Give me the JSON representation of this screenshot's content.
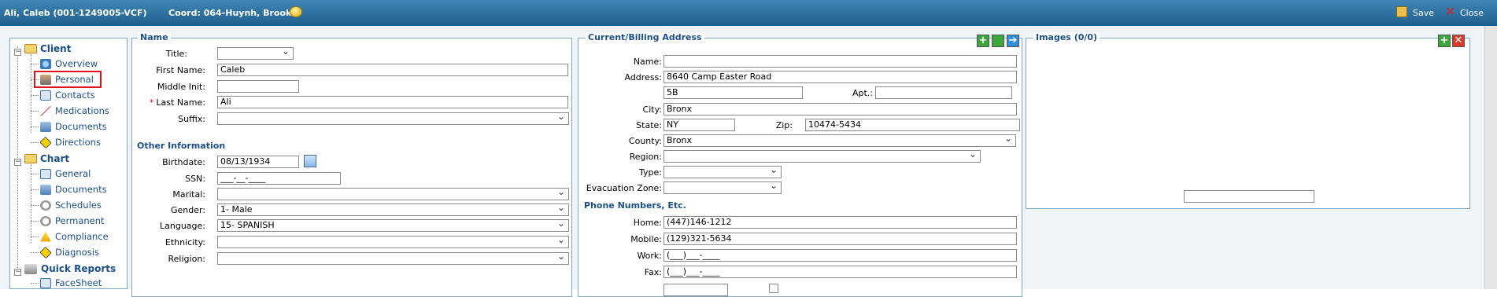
{
  "titlebar": {
    "patient": "Ali, Caleb (001-1249005-VCF)",
    "coord": "Coord: 064-Huynh, Brooks",
    "save_label": "Save",
    "close_label": "Close"
  },
  "sidebar": {
    "client": {
      "label": "Client",
      "items": [
        "Overview",
        "Personal",
        "Contacts",
        "Medications",
        "Documents",
        "Directions"
      ]
    },
    "chart": {
      "label": "Chart",
      "items": [
        "General",
        "Documents",
        "Schedules",
        "Permanent",
        "Compliance",
        "Diagnosis"
      ]
    },
    "reports": {
      "label": "Quick Reports",
      "items": [
        "FaceSheet"
      ]
    },
    "selected": "Personal"
  },
  "name_panel": {
    "title": "Name",
    "title_label": "Title:",
    "title_value": "",
    "first_name_label": "First Name:",
    "first_name": "Caleb",
    "middle_label": "Middle Init:",
    "middle": "",
    "last_name_label": "Last Name:",
    "last_name": "Ali",
    "suffix_label": "Suffix:",
    "suffix": "",
    "other_title": "Other Information",
    "birthdate_label": "Birthdate:",
    "birthdate": "08/13/1934",
    "ssn_label": "SSN:",
    "ssn": "___-__-____",
    "marital_label": "Marital:",
    "marital": "",
    "gender_label": "Gender:",
    "gender": "1- Male",
    "language_label": "Language:",
    "language": "15- SPANISH",
    "ethnicity_label": "Ethnicity:",
    "ethnicity": "",
    "religion_label": "Religion:",
    "religion": ""
  },
  "address_panel": {
    "title": "Current/Billing Address",
    "name_label": "Name:",
    "name": "",
    "address_label": "Address:",
    "address": "8640 Camp Easter Road",
    "address2": "5B",
    "apt_label": "Apt.:",
    "apt": "",
    "city_label": "City:",
    "city": "Bronx",
    "state_label": "State:",
    "state": "NY",
    "zip_label": "Zip:",
    "zip": "10474-5434",
    "county_label": "County:",
    "county": "Bronx",
    "region_label": "Region:",
    "region": "",
    "type_label": "Type:",
    "type": "",
    "evac_label": "Evacuation Zone:",
    "evac": "",
    "phones_title": "Phone Numbers, Etc.",
    "home_label": "Home:",
    "home": "(447)146-1212",
    "mobile_label": "Mobile:",
    "mobile": "(129)321-5634",
    "work_label": "Work:",
    "work": "(___)___-____",
    "fax_label": "Fax:",
    "fax": "(___)___-____"
  },
  "images_panel": {
    "title": "Images (0/0)",
    "caption": ""
  },
  "colors": {
    "titlebar": "#2a6e9f",
    "accent": "#1b4f8a",
    "highlight": "#e0141e"
  }
}
